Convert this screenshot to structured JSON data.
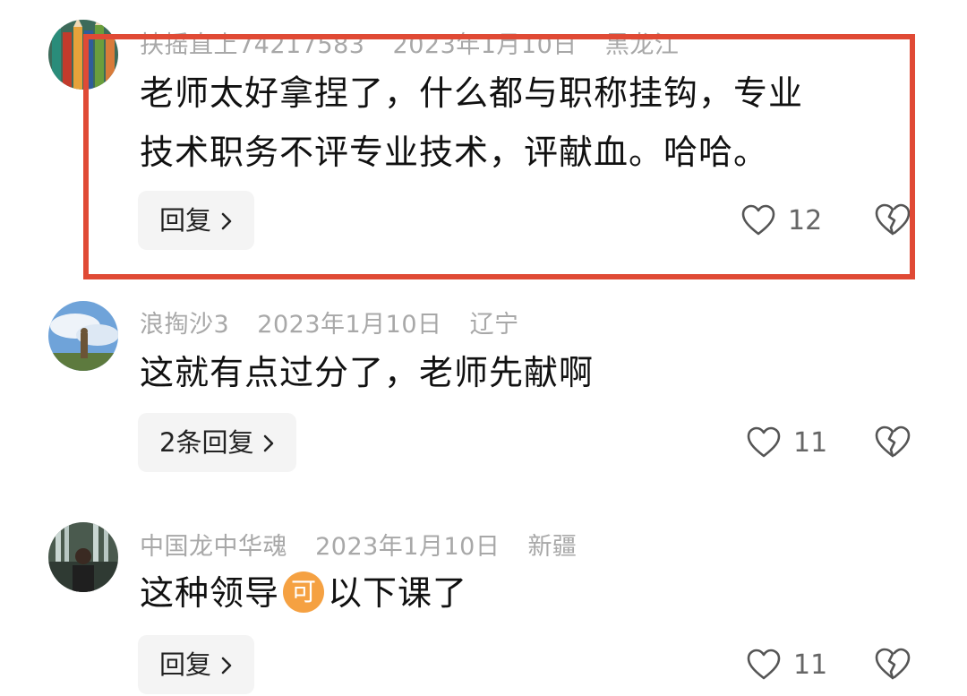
{
  "comments": [
    {
      "username": "扶摇直上74217583",
      "date": "2023年1月10日",
      "location": "黑龙江",
      "lines": [
        "老师太好拿捏了，什么都与职称挂钩，专业",
        "技术职务不评专业技术，评献血。哈哈。"
      ],
      "reply_label": "回复",
      "likes": "12",
      "avatar_icon": "pencils-avatar-icon"
    },
    {
      "username": "浪掏沙3",
      "date": "2023年1月10日",
      "location": "辽宁",
      "lines": [
        "这就有点过分了，老师先献啊"
      ],
      "reply_label": "2条回复",
      "likes": "11",
      "avatar_icon": "statue-sky-avatar-icon"
    },
    {
      "username": "中国龙中华魂",
      "date": "2023年1月10日",
      "location": "新疆",
      "text_before": "这种领导",
      "emoji": "可",
      "text_after": "以下课了",
      "reply_label": "回复",
      "likes": "11",
      "avatar_icon": "waterfall-person-avatar-icon"
    }
  ],
  "colors": {
    "highlight_border": "#e04a35",
    "meta_text": "#a8a8a8",
    "emoji_bg": "#f5a142"
  }
}
